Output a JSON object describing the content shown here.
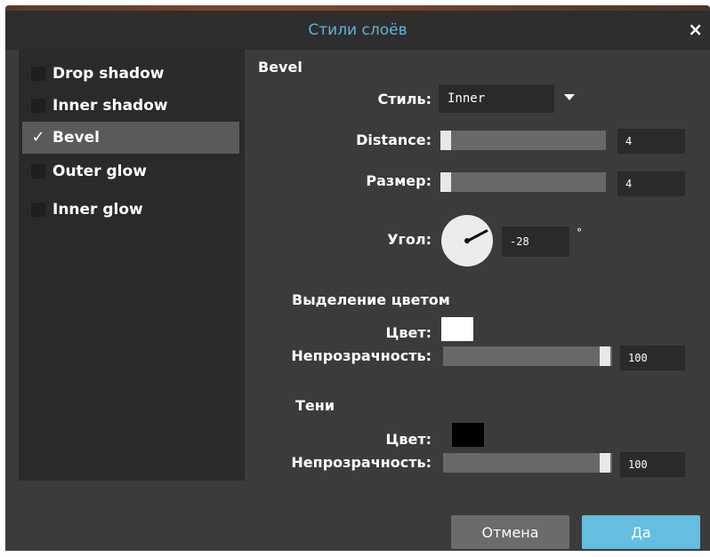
{
  "dialog": {
    "title": "Стили слоёв",
    "close_label": "×"
  },
  "sidebar": {
    "items": [
      {
        "label": "Drop shadow",
        "checked": false
      },
      {
        "label": "Inner shadow",
        "checked": false
      },
      {
        "label": "Bevel",
        "checked": true,
        "check_mark": "✓"
      },
      {
        "label": "Outer glow",
        "checked": false
      },
      {
        "label": "Inner glow",
        "checked": false
      }
    ]
  },
  "bevel": {
    "heading": "Bevel",
    "style_label": "Стиль:",
    "style_value": "Inner",
    "distance_label": "Distance:",
    "distance_value": "4",
    "size_label": "Размер:",
    "size_value": "4",
    "angle_label": "Угол:",
    "angle_value": "-28",
    "angle_unit": "°"
  },
  "highlight": {
    "heading": "Выделение цветом",
    "color_label": "Цвет:",
    "color": "#ffffff",
    "opacity_label": "Непрозрачность:",
    "opacity_value": "100"
  },
  "shadows": {
    "heading": "Тени",
    "color_label": "Цвет:",
    "color": "#000000",
    "opacity_label": "Непрозрачность:",
    "opacity_value": "100"
  },
  "buttons": {
    "cancel": "Отмена",
    "ok": "Да"
  },
  "colors": {
    "accent": "#65bde0",
    "title": "#5fb4d8"
  }
}
